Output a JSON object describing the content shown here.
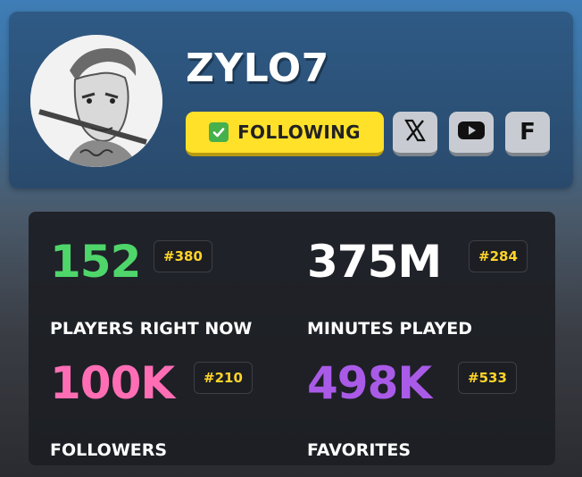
{
  "profile": {
    "username": "ZYLO7",
    "follow_label": "FOLLOWING",
    "avatar_icon": "sketch-portrait-avatar",
    "socials": [
      {
        "name": "x-icon",
        "glyph": "X"
      },
      {
        "name": "youtube-icon",
        "glyph": "youtube"
      },
      {
        "name": "facebook-icon",
        "glyph": "F"
      }
    ]
  },
  "colors": {
    "green": "#4fd66b",
    "white": "#ffffff",
    "pink": "#ff6eb4",
    "purple": "#a95be8",
    "rank": "#ffd42a",
    "follow_button": "#ffe12a"
  },
  "stats": [
    {
      "value": "152",
      "rank": "#380",
      "label": "PLAYERS RIGHT NOW",
      "color": "green"
    },
    {
      "value": "375M",
      "rank": "#284",
      "label": "MINUTES PLAYED",
      "color": "white"
    },
    {
      "value": "100K",
      "rank": "#210",
      "label": "FOLLOWERS",
      "color": "pink"
    },
    {
      "value": "498K",
      "rank": "#533",
      "label": "FAVORITES",
      "color": "purple"
    }
  ]
}
